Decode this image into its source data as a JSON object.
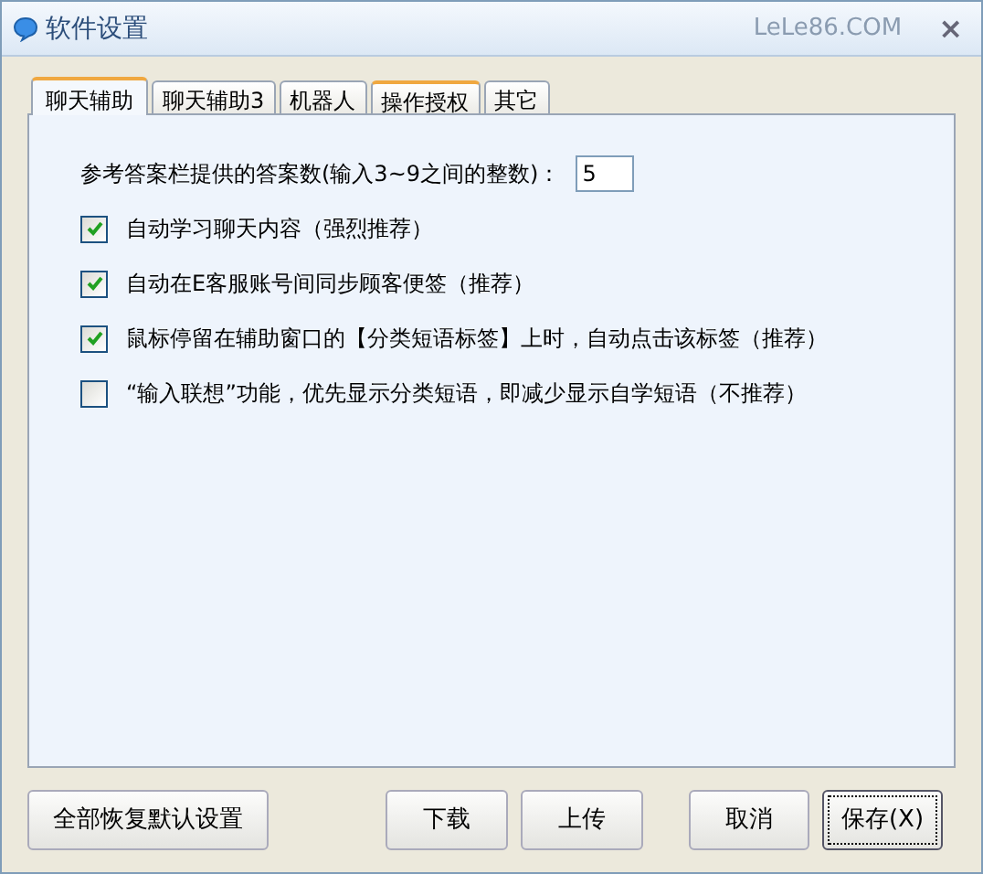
{
  "window": {
    "title": "软件设置",
    "brand": "LeLe86.COM",
    "close": "×"
  },
  "tabs": [
    {
      "label": "聊天辅助",
      "selected": true,
      "highlighted": true
    },
    {
      "label": "聊天辅助3",
      "selected": false,
      "highlighted": false
    },
    {
      "label": "机器人",
      "selected": false,
      "highlighted": false
    },
    {
      "label": "操作授权",
      "selected": false,
      "highlighted": true
    },
    {
      "label": "其它",
      "selected": false,
      "highlighted": false
    }
  ],
  "answer_count": {
    "label": "参考答案栏提供的答案数(输入3~9之间的整数)：",
    "value": "5"
  },
  "options": [
    {
      "label": "自动学习聊天内容（强烈推荐）",
      "checked": true
    },
    {
      "label": "自动在E客服账号间同步顾客便签（推荐）",
      "checked": true
    },
    {
      "label": "鼠标停留在辅助窗口的【分类短语标签】上时，自动点击该标签（推荐）",
      "checked": true
    },
    {
      "label": "“输入联想”功能，优先显示分类短语，即减少显示自学短语（不推荐）",
      "checked": false
    }
  ],
  "buttons": {
    "left": [
      {
        "label": "全部恢复默认设置",
        "focused": false
      }
    ],
    "middle": [
      {
        "label": "下载",
        "focused": false
      },
      {
        "label": "上传",
        "focused": false
      }
    ],
    "right": [
      {
        "label": "取消",
        "focused": false
      },
      {
        "label": "保存(X)",
        "focused": true
      }
    ]
  }
}
